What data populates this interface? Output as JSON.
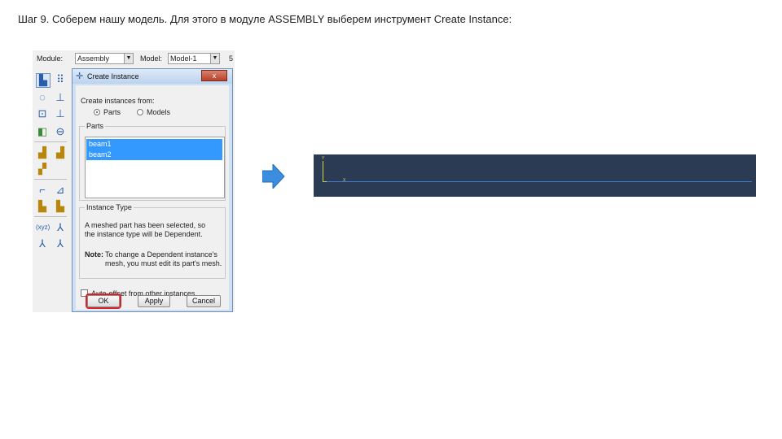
{
  "caption": "Шаг 9. Соберем нашу модель. Для этого в модуле ASSEMBLY выберем инструмент Create Instance:",
  "context_bar": {
    "module_label": "Module:",
    "module_value": "Assembly",
    "model_label": "Model:",
    "model_value": "Model-1",
    "step_fragment": "5"
  },
  "dialog": {
    "title": "Create Instance",
    "close_label": "x",
    "create_from_label": "Create instances from:",
    "option_parts": "Parts",
    "option_models": "Models",
    "parts_group_title": "Parts",
    "parts": [
      "beam1",
      "beam2"
    ],
    "instance_type_title": "Instance Type",
    "instance_type_text_line1": "A meshed part has been selected, so",
    "instance_type_text_line2": "the instance type will be Dependent.",
    "note_label": "Note:",
    "note_line1": "To change a Dependent instance's",
    "note_line2": "mesh, you must edit its part's mesh.",
    "auto_offset_label": "Auto-offset from other instances",
    "ok_label": "OK",
    "apply_label": "Apply",
    "cancel_label": "Cancel"
  },
  "viewport": {
    "axis_y_label": "Y",
    "axis_x_label": "X"
  },
  "colors": {
    "selection": "#3399ff",
    "viewport_bg": "#2b3b54",
    "arrow": "#3b8de0",
    "ok_highlight": "#d8232a"
  }
}
